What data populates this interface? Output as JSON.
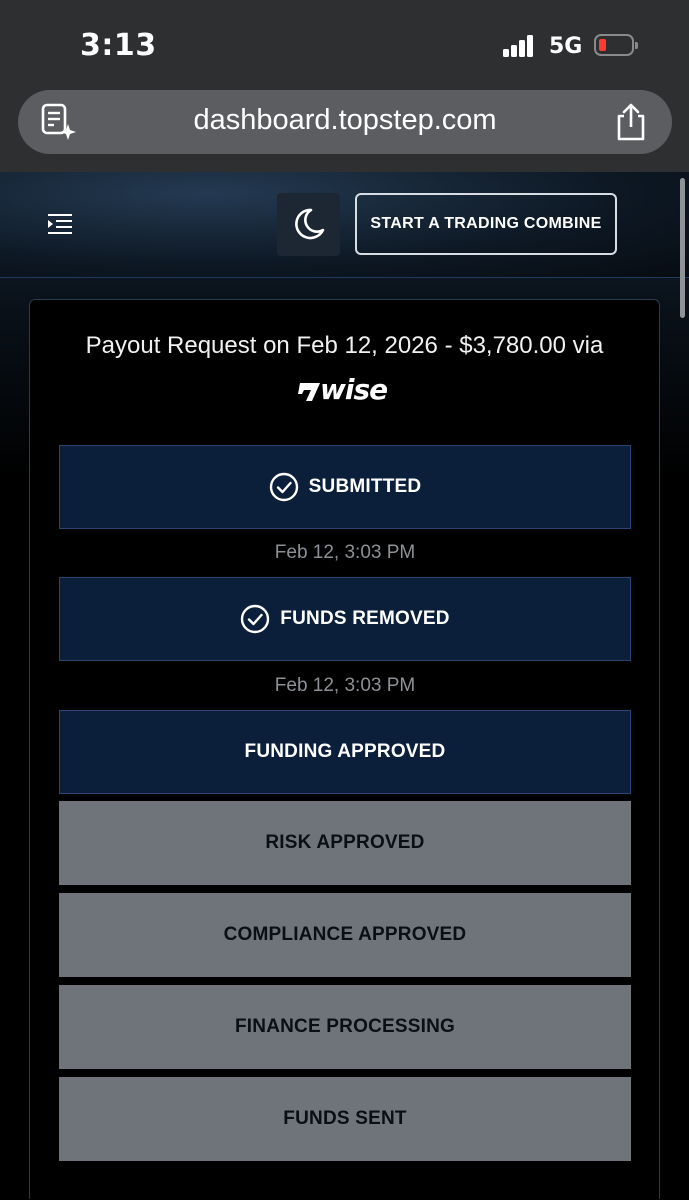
{
  "status_bar": {
    "time": "3:13",
    "network": "5G"
  },
  "browser": {
    "url": "dashboard.topstep.com",
    "reader_icon": "reader-icon",
    "share_icon": "share-icon"
  },
  "header": {
    "menu_icon": "menu-expand-icon",
    "theme_icon": "moon-icon",
    "cta_label": "START A TRADING COMBINE"
  },
  "payout": {
    "title": "Payout Request on Feb 12, 2026 - $3,780.00 via",
    "provider": "wise",
    "steps": [
      {
        "label": "SUBMITTED",
        "status": "complete",
        "timestamp": "Feb 12, 3:03 PM"
      },
      {
        "label": "FUNDS REMOVED",
        "status": "complete",
        "timestamp": "Feb 12, 3:03 PM"
      },
      {
        "label": "FUNDING APPROVED",
        "status": "active"
      },
      {
        "label": "RISK APPROVED",
        "status": "pending"
      },
      {
        "label": "COMPLIANCE APPROVED",
        "status": "pending"
      },
      {
        "label": "FINANCE PROCESSING",
        "status": "pending"
      },
      {
        "label": "FUNDS SENT",
        "status": "pending"
      }
    ]
  },
  "colors": {
    "step_complete_bg": "#0b1f3b",
    "step_pending_bg": "#6f747b",
    "battery_low": "#ff3b30"
  }
}
